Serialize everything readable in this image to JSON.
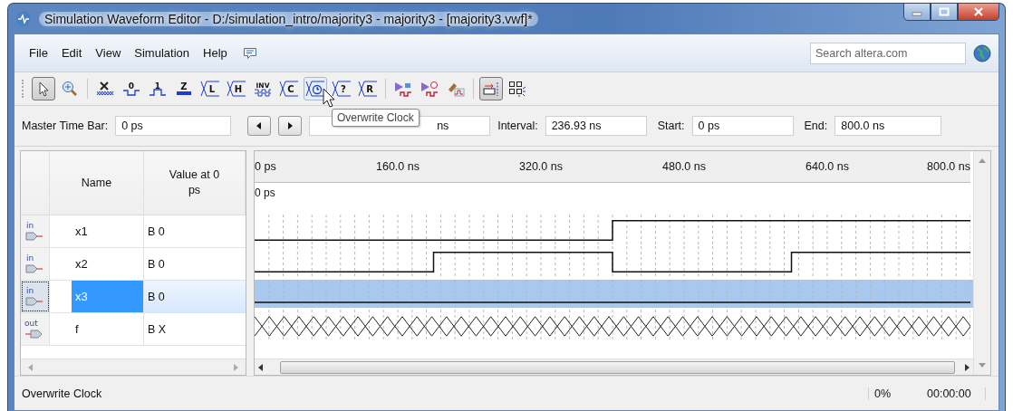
{
  "window": {
    "title": "Simulation Waveform Editor - D:/simulation_intro/majority3 - majority3 - [majority3.vwf]*"
  },
  "menu": [
    {
      "label": "File"
    },
    {
      "label": "Edit"
    },
    {
      "label": "View"
    },
    {
      "label": "Simulation"
    },
    {
      "label": "Help"
    }
  ],
  "search": {
    "placeholder": "Search altera.com"
  },
  "toolbar_groups": [
    [
      {
        "kind": "pointer",
        "selected": true,
        "hovered": false
      },
      {
        "kind": "zoom",
        "selected": false,
        "hovered": false
      }
    ],
    [
      {
        "kind": "unknown",
        "selected": false,
        "hovered": false
      },
      {
        "kind": "low",
        "glyph": "0",
        "selected": false,
        "hovered": false
      },
      {
        "kind": "high",
        "glyph": "1",
        "selected": false,
        "hovered": false
      },
      {
        "kind": "z",
        "glyph": "Z",
        "selected": false,
        "hovered": false
      },
      {
        "kind": "bus-letter",
        "glyph": "L",
        "selected": false,
        "hovered": false
      },
      {
        "kind": "bus-letter",
        "glyph": "H",
        "selected": false,
        "hovered": false
      },
      {
        "kind": "invert",
        "glyph": "INV",
        "selected": false,
        "hovered": false
      },
      {
        "kind": "bus-letter",
        "glyph": "C",
        "selected": false,
        "hovered": false
      },
      {
        "kind": "clock",
        "selected": false,
        "hovered": true
      },
      {
        "kind": "bus-letter",
        "glyph": "?",
        "selected": false,
        "hovered": false
      },
      {
        "kind": "bus-letter",
        "glyph": "R",
        "selected": false,
        "hovered": false
      }
    ],
    [
      {
        "kind": "run",
        "selected": false,
        "hovered": false
      },
      {
        "kind": "run-timed",
        "selected": false,
        "hovered": false
      },
      {
        "kind": "netlist",
        "selected": false,
        "hovered": false
      }
    ],
    [
      {
        "kind": "snap",
        "selected": true,
        "hovered": false
      },
      {
        "kind": "group",
        "selected": false,
        "hovered": false
      }
    ]
  ],
  "tooltip": "Overwrite Clock",
  "time_bar": {
    "master_label": "Master Time Bar:",
    "master_value": "0 ps",
    "pointer_value": "ns",
    "interval_label": "Interval:",
    "interval_value": "236.93 ns",
    "start_label": "Start:",
    "start_value": "0 ps",
    "end_label": "End:",
    "end_value": "800.0 ns"
  },
  "columns": [
    "Name",
    "Value at 0 ps"
  ],
  "ruler": [
    "0 ps",
    "160.0 ns",
    "320.0 ns",
    "480.0 ns",
    "640.0 ns",
    "800.0 ns"
  ],
  "time_marker": "0 ps",
  "signals": [
    {
      "direction": "in",
      "name": "x1",
      "value": "B 0",
      "kind": "binary",
      "selected": false
    },
    {
      "direction": "in",
      "name": "x2",
      "value": "B 0",
      "kind": "binary",
      "selected": false
    },
    {
      "direction": "in",
      "name": "x3",
      "value": "B 0",
      "kind": "binary",
      "selected": true
    },
    {
      "direction": "out",
      "name": "f",
      "value": "B X",
      "kind": "unknown",
      "selected": false
    }
  ],
  "status_bar": {
    "message": "Overwrite Clock",
    "progress": "0%",
    "elapsed": "00:00:00"
  }
}
